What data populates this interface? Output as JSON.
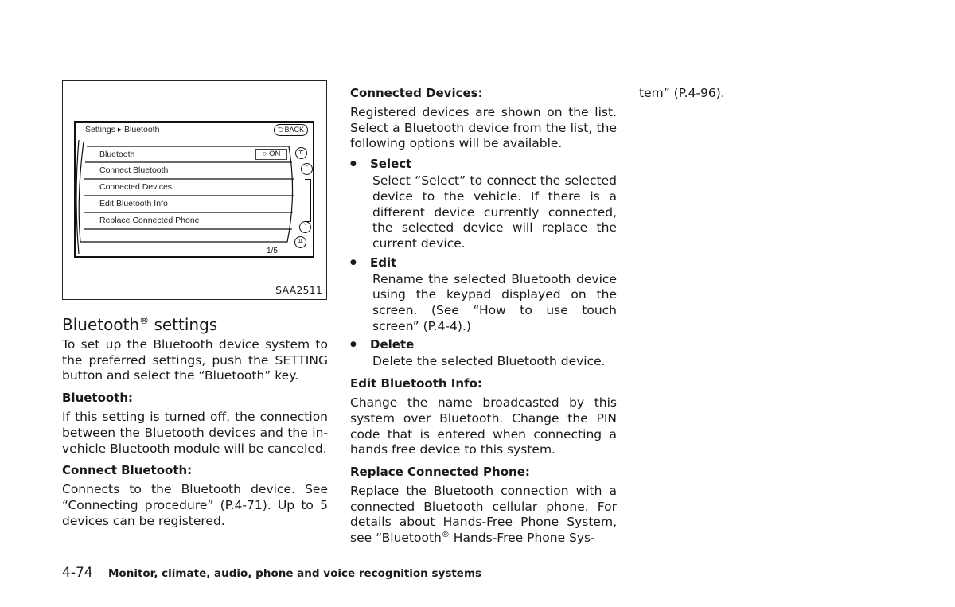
{
  "figure": {
    "code": "SAA2511",
    "screen": {
      "breadcrumb": "Settings ▸ Bluetooth",
      "back_label": "BACK",
      "back_icon": "return-arrow-icon",
      "menu_items": [
        {
          "label": "Bluetooth",
          "toggle": "ON"
        },
        {
          "label": "Connect Bluetooth"
        },
        {
          "label": "Connected Devices"
        },
        {
          "label": "Edit Bluetooth Info"
        },
        {
          "label": "Replace Connected Phone"
        }
      ],
      "page_indicator": "1/5",
      "scroll_icons": {
        "page_up": "double-chevron-up-icon",
        "up": "chevron-up-icon",
        "down": "chevron-down-icon",
        "page_down": "double-chevron-down-icon"
      }
    }
  },
  "left_column": {
    "title": "Bluetooth",
    "title_mark": "®",
    "title_rest": " settings",
    "intro": "To set up the Bluetooth device system to the preferred settings, push the SETTING button and select the “Bluetooth” key.",
    "sections": [
      {
        "heading": "Bluetooth:",
        "body": "If this setting is turned off, the connection between the Bluetooth devices and the in-vehicle Bluetooth module will be canceled."
      },
      {
        "heading": "Connect Bluetooth:",
        "body": "Connects to the Bluetooth device. See “Connecting procedure” (P.4-71). Up to 5 devices can be registered."
      }
    ]
  },
  "middle_column": {
    "connected_devices": {
      "heading": "Connected Devices:",
      "body": "Registered devices are shown on the list. Select a Bluetooth device from the list, the following options will be available.",
      "options": [
        {
          "name": "Select",
          "desc": "Select “Select” to connect the selected device to the vehicle. If there is a different device currently connected, the selected device will replace the current device."
        },
        {
          "name": "Edit",
          "desc": "Rename the selected Bluetooth device using the keypad displayed on the screen. (See “How to use touch screen” (P.4-4).)"
        },
        {
          "name": "Delete",
          "desc": "Delete the selected Bluetooth device."
        }
      ]
    },
    "edit_info": {
      "heading": "Edit Bluetooth Info:",
      "body": "Change the name broadcasted by this system over Bluetooth. Change the PIN code that is entered when connecting a hands free device to this system."
    },
    "replace_phone": {
      "heading": "Replace Connected Phone:",
      "body_before": "Replace the Bluetooth connection with a connected Bluetooth cellular phone. For details about Hands-Free Phone System, see “Bluetooth",
      "body_mark": "®",
      "body_after": " Hands-Free Phone Sys-"
    }
  },
  "right_column": {
    "continuation": "tem” (P.4-96)."
  },
  "footer": {
    "page_number": "4-74",
    "chapter_title": "Monitor, climate, audio, phone and voice recognition systems"
  }
}
